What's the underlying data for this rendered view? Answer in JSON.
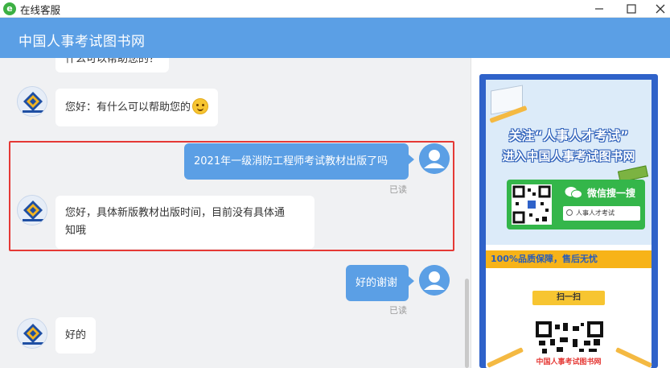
{
  "window": {
    "title": "在线客服",
    "app_icon_glyph": "e"
  },
  "header": {
    "title": "中国人事考试图书网"
  },
  "messages": [
    {
      "side": "left",
      "text": "什么可以帮助您的？"
    },
    {
      "side": "left",
      "text": "您好：有什么可以帮助您的",
      "emoji": "smile-emoji"
    },
    {
      "side": "right",
      "text": "2021年一级消防工程师考试教材出版了吗",
      "status": "已读"
    },
    {
      "side": "left",
      "text_line1": "您好，具体新版教材出版时间，目前没有具体通",
      "text_line2": "知哦"
    },
    {
      "side": "right",
      "text": "好的谢谢",
      "status": "已读"
    },
    {
      "side": "left",
      "text": "好的"
    }
  ],
  "poster": {
    "line1": "关注“人事人才考试”",
    "line2": "进入中国人事考试图书网",
    "wechat_label": "微信搜一搜",
    "search_text": "人事人才考试",
    "quality": "100%品质保障，售后无忧",
    "scan": "扫一扫",
    "caption": "中国人事考试图书网"
  },
  "colors": {
    "header_bg": "#5b9fe5",
    "chat_bg": "#f0f1f3",
    "user_bubble": "#5b9fe5",
    "highlight_border": "#e53935",
    "poster_blue": "#2f62c9",
    "wechat_green": "#34b64a"
  },
  "icons": {
    "minimize": "minimize-icon",
    "maximize": "maximize-icon",
    "close": "close-icon",
    "agent_avatar": "agent-logo-avatar",
    "user_avatar": "user-silhouette-avatar"
  }
}
